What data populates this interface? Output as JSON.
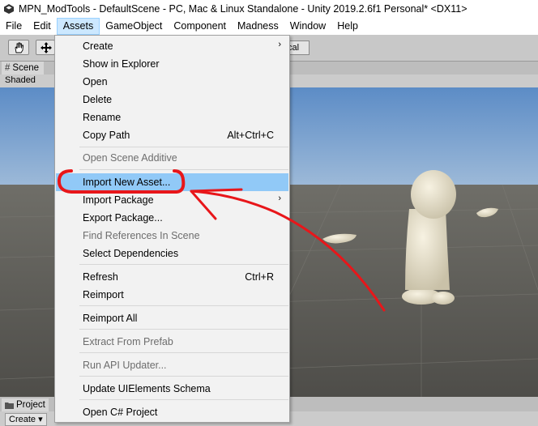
{
  "window": {
    "title": "MPN_ModTools - DefaultScene - PC, Mac & Linux Standalone - Unity 2019.2.6f1 Personal* <DX11>"
  },
  "menubar": [
    "File",
    "Edit",
    "Assets",
    "GameObject",
    "Component",
    "Madness",
    "Window",
    "Help"
  ],
  "toolbar": {
    "local_label": "cal"
  },
  "scene": {
    "tab_label": "Scene",
    "shading_mode": "Shaded"
  },
  "project": {
    "tab_label": "Project",
    "create_label": "Create"
  },
  "assets_menu": {
    "items": [
      {
        "label": "Create",
        "shortcut": "",
        "submenu": true,
        "disabled": false
      },
      {
        "label": "Show in Explorer",
        "shortcut": "",
        "submenu": false,
        "disabled": false
      },
      {
        "label": "Open",
        "shortcut": "",
        "submenu": false,
        "disabled": false
      },
      {
        "label": "Delete",
        "shortcut": "",
        "submenu": false,
        "disabled": false
      },
      {
        "label": "Rename",
        "shortcut": "",
        "submenu": false,
        "disabled": false
      },
      {
        "label": "Copy Path",
        "shortcut": "Alt+Ctrl+C",
        "submenu": false,
        "disabled": false
      },
      {
        "label": "Open Scene Additive",
        "shortcut": "",
        "submenu": false,
        "disabled": true
      },
      {
        "label": "Import New Asset...",
        "shortcut": "",
        "submenu": false,
        "disabled": false,
        "highlighted": true
      },
      {
        "label": "Import Package",
        "shortcut": "",
        "submenu": true,
        "disabled": false
      },
      {
        "label": "Export Package...",
        "shortcut": "",
        "submenu": false,
        "disabled": false
      },
      {
        "label": "Find References In Scene",
        "shortcut": "",
        "submenu": false,
        "disabled": true
      },
      {
        "label": "Select Dependencies",
        "shortcut": "",
        "submenu": false,
        "disabled": false
      },
      {
        "label": "Refresh",
        "shortcut": "Ctrl+R",
        "submenu": false,
        "disabled": false
      },
      {
        "label": "Reimport",
        "shortcut": "",
        "submenu": false,
        "disabled": false
      },
      {
        "label": "Reimport All",
        "shortcut": "",
        "submenu": false,
        "disabled": false
      },
      {
        "label": "Extract From Prefab",
        "shortcut": "",
        "submenu": false,
        "disabled": true
      },
      {
        "label": "Run API Updater...",
        "shortcut": "",
        "submenu": false,
        "disabled": true
      },
      {
        "label": "Update UIElements Schema",
        "shortcut": "",
        "submenu": false,
        "disabled": false
      },
      {
        "label": "Open C# Project",
        "shortcut": "",
        "submenu": false,
        "disabled": false
      }
    ]
  },
  "icons": {
    "hand_tool": "hand-icon",
    "move_tool": "move-icon",
    "app": "unity-app-icon",
    "submenu": "chevron-right-icon"
  },
  "colors": {
    "highlight": "#91c9f7",
    "annotation": "#e8161a",
    "sky": "#6f9ccd",
    "ground": "#5b5b56",
    "figure": "#ece6d4"
  }
}
